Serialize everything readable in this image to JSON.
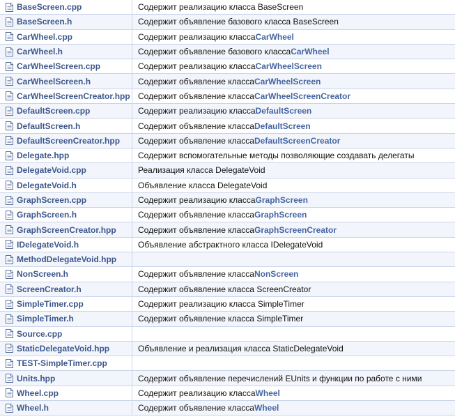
{
  "colors": {
    "link": "#3d578c",
    "class_link": "#4665a2",
    "border": "#c9d4e9",
    "alt_row": "#f2f5fb"
  },
  "icons": {
    "file": "document-file-icon"
  },
  "rows": [
    {
      "name": "BaseScreen.cpp",
      "desc_prefix": "Содержит реализацию класса BaseScreen",
      "desc_link": ""
    },
    {
      "name": "BaseScreen.h",
      "desc_prefix": "Содержит объявление базового класса BaseScreen",
      "desc_link": ""
    },
    {
      "name": "CarWheel.cpp",
      "desc_prefix": "Содержит реализацию класса ",
      "desc_link": "CarWheel"
    },
    {
      "name": "CarWheel.h",
      "desc_prefix": "Содержит объявление базового класса ",
      "desc_link": "CarWheel"
    },
    {
      "name": "CarWheelScreen.cpp",
      "desc_prefix": "Содержит реализацию класса ",
      "desc_link": "CarWheelScreen"
    },
    {
      "name": "CarWheelScreen.h",
      "desc_prefix": "Содержит объявление класса ",
      "desc_link": "CarWheelScreen"
    },
    {
      "name": "CarWheelScreenCreator.hpp",
      "desc_prefix": "Содержит объявление класса ",
      "desc_link": "CarWheelScreenCreator"
    },
    {
      "name": "DefaultScreen.cpp",
      "desc_prefix": "Содержит реализацию класса ",
      "desc_link": "DefaultScreen"
    },
    {
      "name": "DefaultScreen.h",
      "desc_prefix": "Содержит объявление класса ",
      "desc_link": "DefaultScreen"
    },
    {
      "name": "DefaultScreenCreator.hpp",
      "desc_prefix": "Содержит объявление класса ",
      "desc_link": "DefaultScreenCreator"
    },
    {
      "name": "Delegate.hpp",
      "desc_prefix": "Содержит вспомогательные методы позволяющие создавать делегаты",
      "desc_link": ""
    },
    {
      "name": "DelegateVoid.cpp",
      "desc_prefix": "Реализация класса DelegateVoid",
      "desc_link": ""
    },
    {
      "name": "DelegateVoid.h",
      "desc_prefix": "Объявление класса DelegateVoid",
      "desc_link": ""
    },
    {
      "name": "GraphScreen.cpp",
      "desc_prefix": "Содержит реализацию класса ",
      "desc_link": "GraphScreen"
    },
    {
      "name": "GraphScreen.h",
      "desc_prefix": "Содержит объявление класса ",
      "desc_link": "GraphScreen"
    },
    {
      "name": "GraphScreenCreator.hpp",
      "desc_prefix": "Содержит объявление класса ",
      "desc_link": "GraphScreenCreator"
    },
    {
      "name": "IDelegateVoid.h",
      "desc_prefix": "Объявление абстрактного класса IDelegateVoid",
      "desc_link": ""
    },
    {
      "name": "MethodDelegateVoid.hpp",
      "desc_prefix": "",
      "desc_link": ""
    },
    {
      "name": "NonScreen.h",
      "desc_prefix": "Содержит объявление класса ",
      "desc_link": "NonScreen"
    },
    {
      "name": "ScreenCreator.h",
      "desc_prefix": "Содержит объявление класса ScreenCreator",
      "desc_link": ""
    },
    {
      "name": "SimpleTimer.cpp",
      "desc_prefix": "Содержит реализацию класса SimpleTimer",
      "desc_link": ""
    },
    {
      "name": "SimpleTimer.h",
      "desc_prefix": "Содержит объявление класса SimpleTimer",
      "desc_link": ""
    },
    {
      "name": "Source.cpp",
      "desc_prefix": "",
      "desc_link": ""
    },
    {
      "name": "StaticDelegateVoid.hpp",
      "desc_prefix": "Объявление и реализация класса StaticDelegateVoid",
      "desc_link": ""
    },
    {
      "name": "TEST-SimpleTimer.cpp",
      "desc_prefix": "",
      "desc_link": ""
    },
    {
      "name": "Units.hpp",
      "desc_prefix": "Содержит объявление перечислений EUnits и функции по работе с ними",
      "desc_link": ""
    },
    {
      "name": "Wheel.cpp",
      "desc_prefix": "Содержит реализацию класса ",
      "desc_link": "Wheel"
    },
    {
      "name": "Wheel.h",
      "desc_prefix": "Содержит объявление класса ",
      "desc_link": "Wheel"
    }
  ]
}
